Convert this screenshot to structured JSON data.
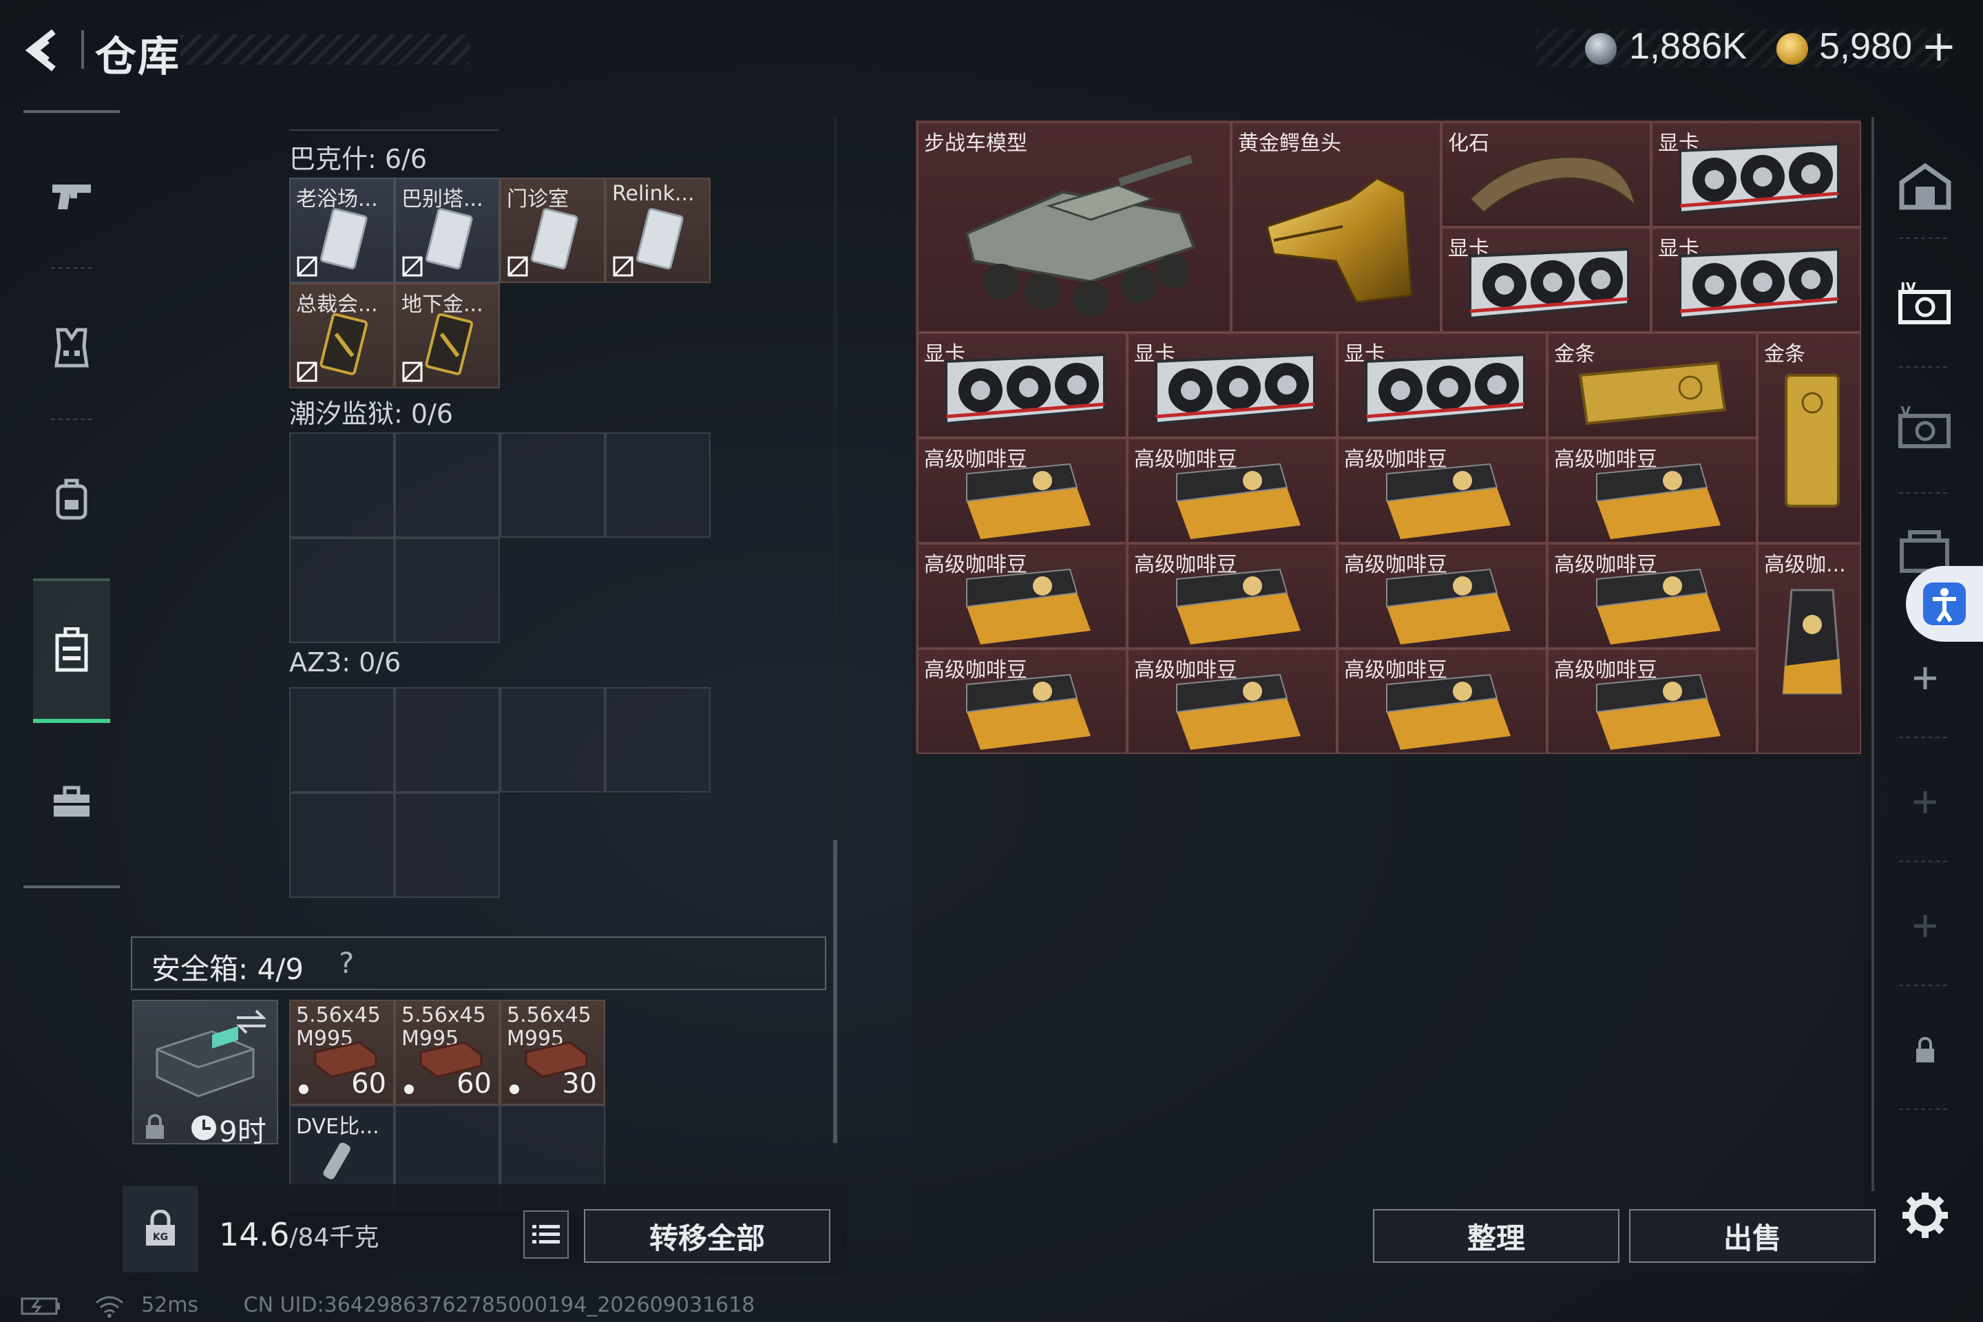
{
  "header": {
    "title": "仓库",
    "currency": [
      {
        "icon": "silver-coin-icon",
        "value": "1,886K"
      },
      {
        "icon": "gold-coin-icon",
        "value": "5,980"
      }
    ],
    "plus": "+"
  },
  "left_nav": {
    "items": [
      {
        "name": "weapon",
        "icon": "pistol-icon"
      },
      {
        "name": "armor",
        "icon": "vest-icon"
      },
      {
        "name": "backpack",
        "icon": "backpack-icon"
      },
      {
        "name": "container",
        "icon": "case-icon",
        "active": true
      },
      {
        "name": "toolbox",
        "icon": "briefcase-icon"
      }
    ]
  },
  "key_sections": [
    {
      "label": "巴克什: 6/6",
      "slots": [
        {
          "label": "老浴场...",
          "type": "key-card"
        },
        {
          "label": "巴别塔...",
          "type": "key-card"
        },
        {
          "label": "门诊室",
          "type": "key-card"
        },
        {
          "label": "Relink...",
          "type": "key-card"
        },
        {
          "label": "总裁会...",
          "type": "gold-card"
        },
        {
          "label": "地下金...",
          "type": "gold-card"
        }
      ]
    },
    {
      "label": "潮汐监狱: 0/6",
      "slots": []
    },
    {
      "label": "AZ3: 0/6",
      "slots": []
    }
  ],
  "safebox": {
    "title": "安全箱: 4/9",
    "help": "?",
    "timer": "9时",
    "ammo": [
      {
        "label": "5.56x45 M995",
        "count": "60"
      },
      {
        "label": "5.56x45 M995",
        "count": "60"
      },
      {
        "label": "5.56x45 M995",
        "count": "30"
      }
    ],
    "extra_item": "DVE比..."
  },
  "footer_left": {
    "weight": "14.6",
    "capacity": "/84千克",
    "transfer_all": "转移全部"
  },
  "stash": {
    "items": [
      {
        "label": "步战车模型",
        "icon": "ifv-model-icon"
      },
      {
        "label": "黄金鳄鱼头",
        "icon": "gold-croc-head-icon"
      },
      {
        "label": "化石",
        "icon": "fossil-claw-icon"
      },
      {
        "label": "显卡",
        "icon": "gpu-icon"
      },
      {
        "label": "显卡",
        "icon": "gpu-icon"
      },
      {
        "label": "显卡",
        "icon": "gpu-icon"
      },
      {
        "label": "显卡",
        "icon": "gpu-icon"
      },
      {
        "label": "显卡",
        "icon": "gpu-icon"
      },
      {
        "label": "显卡",
        "icon": "gpu-icon"
      },
      {
        "label": "金条",
        "icon": "gold-bar-icon"
      },
      {
        "label": "金条",
        "icon": "gold-bar-icon"
      },
      {
        "label": "高级咖啡豆",
        "icon": "coffee-box-icon"
      },
      {
        "label": "高级咖啡豆",
        "icon": "coffee-box-icon"
      },
      {
        "label": "高级咖啡豆",
        "icon": "coffee-box-icon"
      },
      {
        "label": "高级咖啡豆",
        "icon": "coffee-box-icon"
      },
      {
        "label": "高级咖啡豆",
        "icon": "coffee-box-icon"
      },
      {
        "label": "高级咖啡豆",
        "icon": "coffee-box-icon"
      },
      {
        "label": "高级咖啡豆",
        "icon": "coffee-box-icon"
      },
      {
        "label": "高级咖啡豆",
        "icon": "coffee-box-icon"
      },
      {
        "label": "高级咖...",
        "icon": "coffee-bag-icon"
      },
      {
        "label": "高级咖啡豆",
        "icon": "coffee-box-icon"
      },
      {
        "label": "高级咖啡豆",
        "icon": "coffee-box-icon"
      },
      {
        "label": "高级咖啡豆",
        "icon": "coffee-box-icon"
      },
      {
        "label": "高级咖啡豆",
        "icon": "coffee-box-icon"
      }
    ],
    "sort": "整理",
    "sell": "出售"
  },
  "status": {
    "ping": "52ms",
    "uid": "CN UID:3642986376278500019​4_202609031618"
  },
  "colors": {
    "stash_cell": "#4b2b2e",
    "active_nav_accent": "#3fd08c",
    "gold": "#c9a33a"
  }
}
